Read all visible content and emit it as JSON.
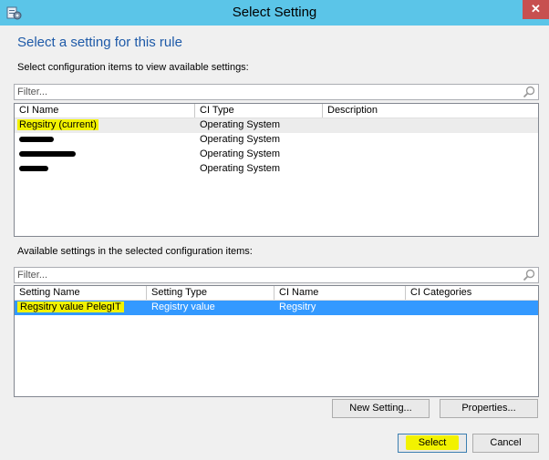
{
  "window": {
    "title": "Select Setting",
    "close_glyph": "✕"
  },
  "heading": "Select a setting for this rule",
  "ci_section": {
    "label": "Select configuration items to view available settings:",
    "filter_placeholder": "Filter...",
    "columns": [
      "CI Name",
      "CI Type",
      "Description"
    ],
    "rows": [
      {
        "name": "Regsitry (current)",
        "type": "Operating System",
        "description": "",
        "redacted": false,
        "selected": true
      },
      {
        "name": "",
        "type": "Operating System",
        "description": "",
        "redacted": true,
        "selected": false
      },
      {
        "name": "",
        "type": "Operating System",
        "description": "",
        "redacted": true,
        "selected": false
      },
      {
        "name": "",
        "type": "Operating System",
        "description": "",
        "redacted": true,
        "selected": false
      }
    ]
  },
  "settings_section": {
    "label": "Available settings in the selected configuration items:",
    "filter_placeholder": "Filter...",
    "columns": [
      "Setting Name",
      "Setting Type",
      "CI Name",
      "CI Categories"
    ],
    "rows": [
      {
        "name": "Regsitry value PelegIT",
        "type": "Registry value",
        "ci_name": "Regsitry",
        "ci_categories": "",
        "selected": true
      }
    ]
  },
  "buttons": {
    "new_setting": "New Setting...",
    "properties": "Properties...",
    "select": "Select",
    "cancel": "Cancel"
  },
  "colors": {
    "titlebar": "#5bc5e8",
    "heading": "#1e5aa8",
    "selection": "#3399ff",
    "highlighter": "#f2f200",
    "close": "#c75050"
  },
  "icons": {
    "app": "settings-app-icon",
    "search": "magnifier-icon"
  }
}
